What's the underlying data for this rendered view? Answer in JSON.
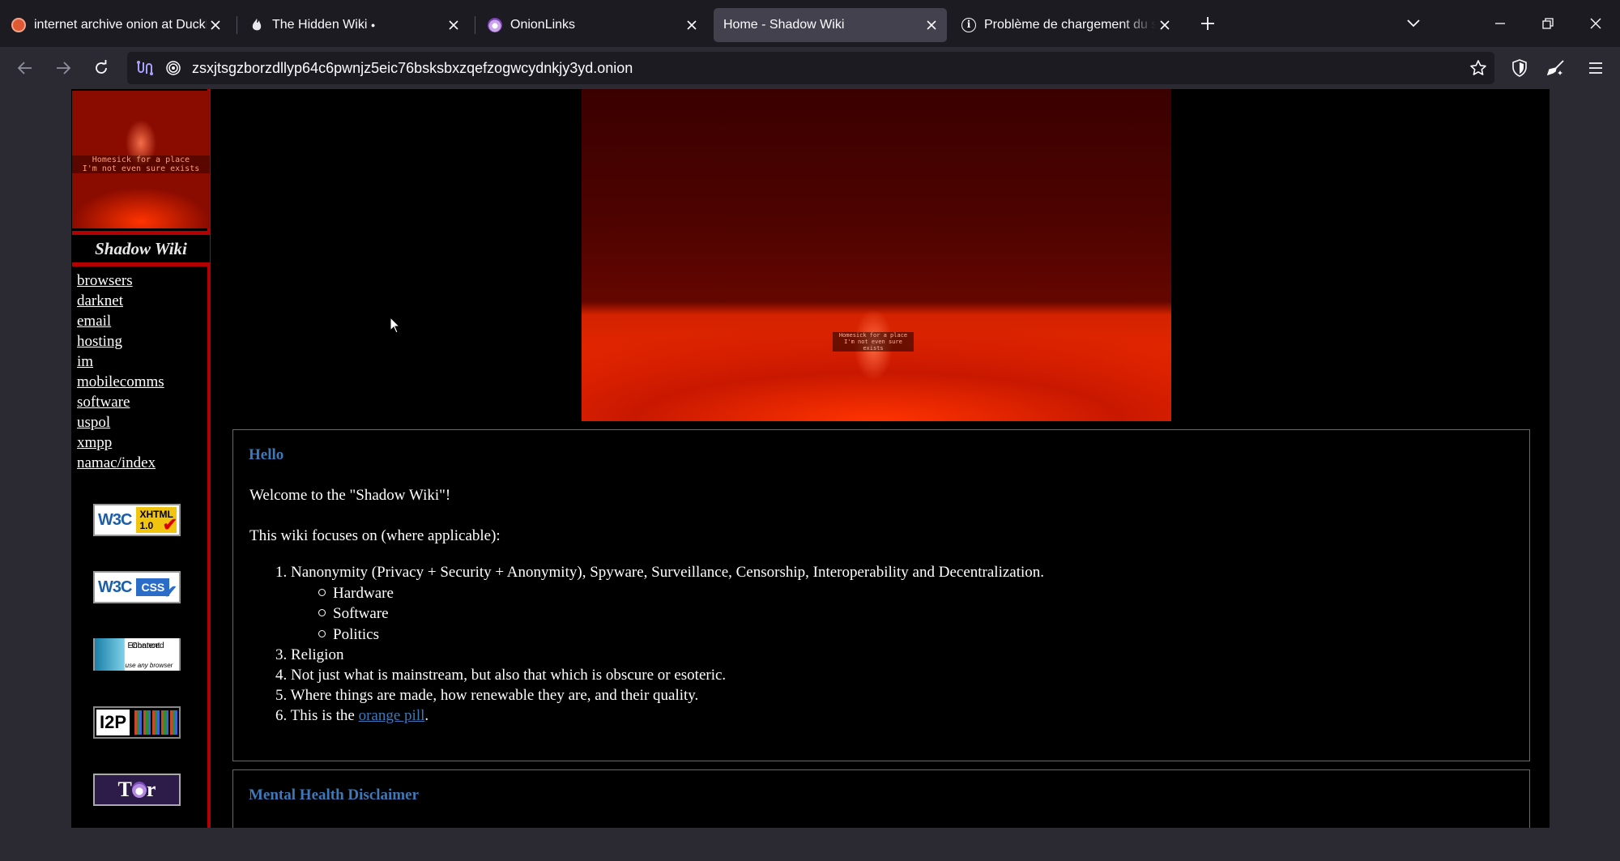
{
  "tabs": [
    {
      "title": "internet archive onion at DuckD",
      "icon": "duckduckgo-icon",
      "active": false
    },
    {
      "title": "The Hidden Wiki",
      "icon": "onion-flame-icon",
      "active": false
    },
    {
      "title": "OnionLinks",
      "icon": "onion-icon",
      "active": false
    },
    {
      "title": "Home - Shadow Wiki",
      "icon": "none",
      "active": true
    },
    {
      "title": "Problème de chargement du sit",
      "icon": "info-icon",
      "active": false
    }
  ],
  "tab_indicator": "●",
  "address_bar": {
    "url": "zsxjtsgzborzdllyp64c6pwnjz5eic76bsksbxzqefzogwcydnkjy3yd.onion"
  },
  "sidebar": {
    "logo_caption_line1": "Homesick for a place",
    "logo_caption_line2": "I'm not even sure exists",
    "title": "Shadow Wiki",
    "links": [
      "browsers",
      "darknet",
      "email",
      "hosting",
      "im",
      "mobilecomms",
      "software",
      "uspol",
      "xmpp",
      "namac/index"
    ],
    "badges": {
      "w3c": "W3C",
      "xhtml": "XHTML",
      "xhtml_version": "1.0",
      "css": "CSS",
      "content_enhanced_line1": "Content",
      "content_enhanced_line2": "Enhanced",
      "content_enhanced_line3": "use any browser",
      "i2p": "I2P",
      "tor_t": "T",
      "tor_r": "r"
    }
  },
  "hero": {
    "caption_line1": "Homesick for a place",
    "caption_line2": "I'm not even sure exists"
  },
  "hello_box": {
    "heading": "Hello",
    "welcome": "Welcome to the \"Shadow Wiki\"!",
    "focus_intro": "This wiki focuses on (where applicable):",
    "items": [
      {
        "num": "1.",
        "text": "Nanonymity (Privacy + Security + Anonymity), Spyware, Surveillance, Censorship, Interoperability and Decentralization."
      },
      {
        "num": "3.",
        "text": "Religion"
      },
      {
        "num": "4.",
        "text": "Not just what is mainstream, but also that which is obscure or esoteric."
      },
      {
        "num": "5.",
        "text": "Where things are made, how renewable they are, and their quality."
      },
      {
        "num": "6.",
        "text": "This is the ",
        "link": "orange pill",
        "after": "."
      }
    ],
    "subitems": [
      "Hardware",
      "Software",
      "Politics"
    ]
  },
  "disclaimer_box": {
    "heading": "Mental Health Disclaimer"
  },
  "colors": {
    "accent_link": "#3d78b8",
    "sidebar_border": "#b30000"
  }
}
